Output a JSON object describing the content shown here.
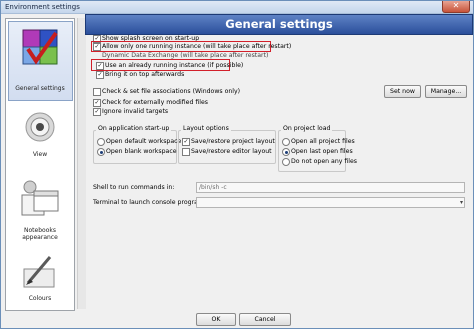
{
  "window": {
    "title": "Environment settings",
    "close_glyph": "✕"
  },
  "sidebar": {
    "items": [
      {
        "label": "General settings",
        "icon": "settings-checkbox-icon"
      },
      {
        "label": "View",
        "icon": "eye-icon"
      },
      {
        "label": "Notebooks appearance",
        "icon": "notebook-icon"
      },
      {
        "label": "Colours",
        "icon": "paintbrush-icon"
      }
    ]
  },
  "header": {
    "title": "General settings"
  },
  "options": {
    "splash": "Show splash screen on start-up",
    "allow_one": "Allow only one running instance (will take place after restart)",
    "dde": "Dynamic Data Exchange (will take place after restart)",
    "use_running": "Use an already running instance (if possible)",
    "bring_top": "Bring it on top afterwards",
    "check_assoc": "Check & set file associations (Windows only)",
    "check_modified": "Check for externally modified files",
    "ignore_targets": "Ignore invalid targets"
  },
  "buttons": {
    "set_now": "Set now",
    "manage": "Manage...",
    "ok": "OK",
    "cancel": "Cancel"
  },
  "groups": {
    "startup": {
      "title": "On application start-up",
      "opt1": "Open default workspace",
      "opt2": "Open blank workspace"
    },
    "layout": {
      "title": "Layout options",
      "opt1": "Save/restore project layout",
      "opt2": "Save/restore editor layout"
    },
    "project_load": {
      "title": "On project load",
      "opt1": "Open all project files",
      "opt2": "Open last open files",
      "opt3": "Do not open any files"
    }
  },
  "shell": {
    "label": "Shell to run commands in:",
    "value": "/bin/sh -c"
  },
  "terminal": {
    "label": "Terminal to launch console programs:",
    "value": "",
    "arrow": "▾"
  }
}
